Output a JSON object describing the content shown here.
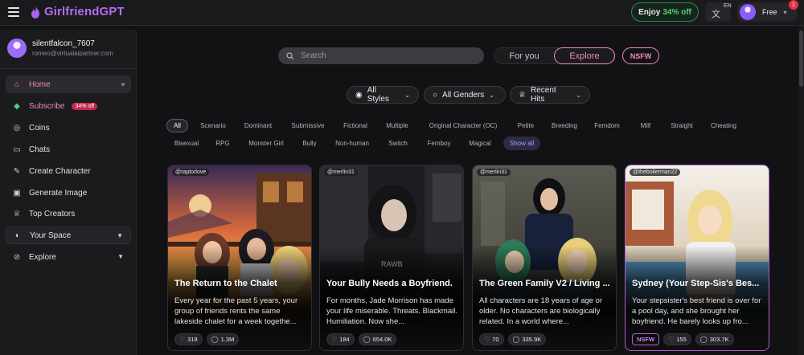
{
  "header": {
    "brand": "GirlfriendGPT",
    "promo_prefix": "Enjoy",
    "promo_accent": "34% off",
    "lang_code": "EN",
    "plan": "Free",
    "notification_count": "1"
  },
  "sidebar": {
    "username": "silentfalcon_7607",
    "email": "romeo@virtualaipartner.com",
    "items": [
      {
        "label": "Home",
        "icon": "home-icon"
      },
      {
        "label": "Subscribe",
        "icon": "gem-icon",
        "badge": "34% off"
      },
      {
        "label": "Coins",
        "icon": "coins-icon"
      },
      {
        "label": "Chats",
        "icon": "chat-icon"
      },
      {
        "label": "Create Character",
        "icon": "edit-icon"
      },
      {
        "label": "Generate Image",
        "icon": "image-icon"
      },
      {
        "label": "Top Creators",
        "icon": "trophy-icon"
      },
      {
        "label": "Your Space",
        "icon": "space-icon"
      },
      {
        "label": "Explore",
        "icon": "compass-icon"
      }
    ]
  },
  "search": {
    "placeholder": "Search"
  },
  "mode": {
    "for_you": "For you",
    "explore": "Explore",
    "nsfw": "NSFW"
  },
  "filters": {
    "styles": "All Styles",
    "genders": "All Genders",
    "sort": "Recent Hits"
  },
  "tags": [
    "All",
    "Scenario",
    "Dominant",
    "Submissive",
    "Fictional",
    "Multiple",
    "Original Character (OC)",
    "Petite",
    "Breeding",
    "Femdom",
    "Milf",
    "Straight",
    "Cheating",
    "Bisexual",
    "RPG",
    "Monster Girl",
    "Bully",
    "Non-human",
    "Switch",
    "Femboy",
    "Magical",
    "Show all"
  ],
  "cards": [
    {
      "handle": "@raptorlove",
      "title": "The Return to the Chalet",
      "desc": "Every year for the past 5 years, your group of friends rents the same lakeside chalet for a week togethe...",
      "likes": "318",
      "chats": "1.3M",
      "nsfw": ""
    },
    {
      "handle": "@merlin31",
      "title": "Your Bully Needs a Boyfriend.",
      "desc": "For months, Jade Morrison has made your life miserable. Threats. Blackmail. Humiliation. Now she...",
      "likes": "184",
      "chats": "654.0K",
      "nsfw": ""
    },
    {
      "handle": "@merlin31",
      "title": "The Green Family V2 / Living ...",
      "desc": "All characters are 18 years of age or older. No characters are biologically related. In a world where...",
      "likes": "70",
      "chats": "335.9K",
      "nsfw": ""
    },
    {
      "handle": "@theboilerman22",
      "title": "Sydney (Your Step-Sis's Bes...",
      "desc": "Your stepsister's best friend is over for a pool day, and she brought her boyfriend. He barely looks up fro...",
      "likes": "155",
      "chats": "303.7K",
      "nsfw": "NSFW"
    }
  ],
  "colors": {
    "accent_pink": "#f08ab8",
    "accent_purple": "#b36cf0",
    "promo_green": "#4bd47b"
  }
}
